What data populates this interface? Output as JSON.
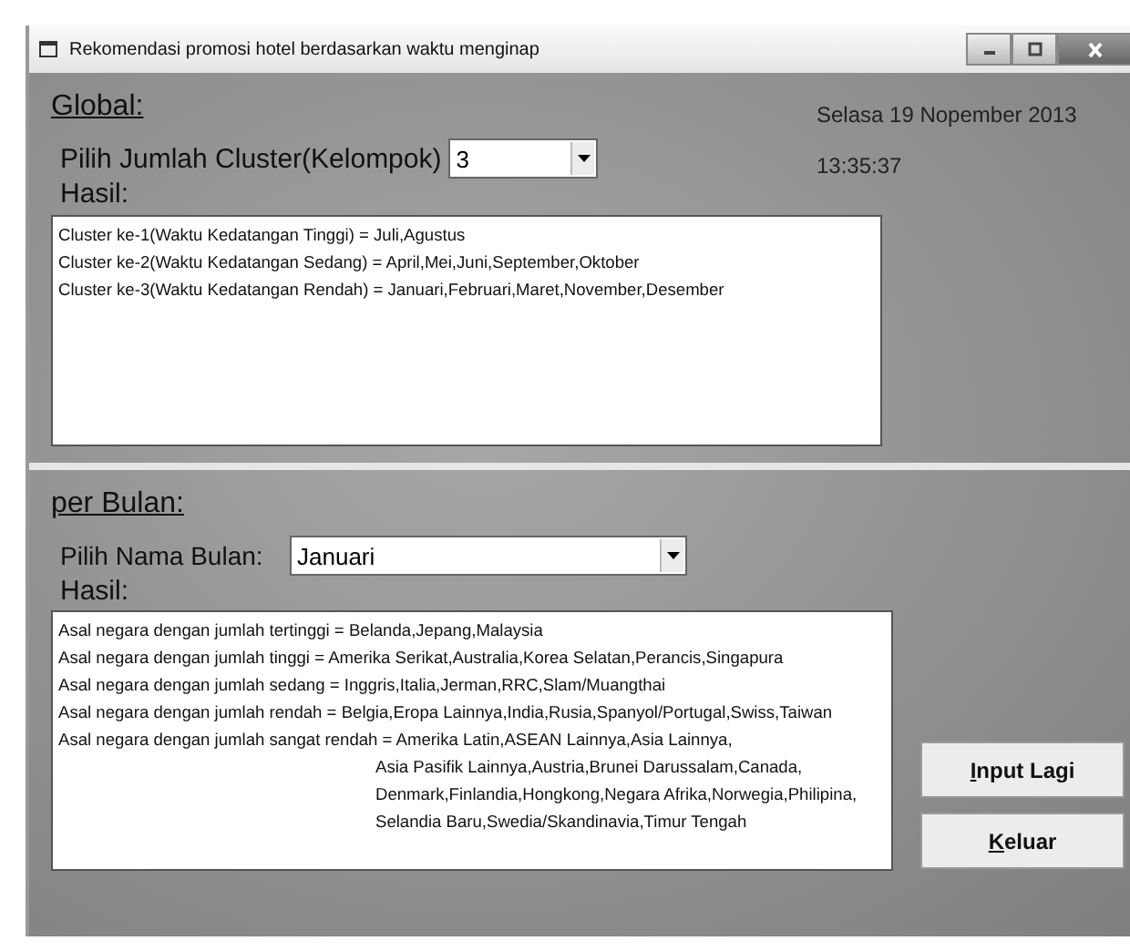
{
  "window": {
    "title": "Rekomendasi promosi hotel berdasarkan waktu menginap"
  },
  "global": {
    "heading": "Global:",
    "date": "Selasa 19 Nopember 2013",
    "time": "13:35:37",
    "cluster_label": "Pilih Jumlah Cluster(Kelompok)",
    "cluster_value": "3",
    "result_label": "Hasil:",
    "results": [
      {
        "kind": "entry",
        "text": "Cluster ke-1(Waktu Kedatangan Tinggi) = Juli,Agustus"
      },
      {
        "kind": "entry",
        "text": "Cluster ke-2(Waktu Kedatangan Sedang) = April,Mei,Juni,September,Oktober"
      },
      {
        "kind": "entry",
        "text": "Cluster ke-3(Waktu Kedatangan Rendah) = Januari,Februari,Maret,November,Desember"
      }
    ]
  },
  "per_bulan": {
    "heading": "per Bulan:",
    "month_label": "Pilih Nama Bulan:",
    "month_value": "Januari",
    "result_label": "Hasil:",
    "results": [
      {
        "kind": "entry",
        "text": "Asal negara dengan jumlah tertinggi = Belanda,Jepang,Malaysia"
      },
      {
        "kind": "entry",
        "text": "Asal negara dengan jumlah tinggi = Amerika Serikat,Australia,Korea Selatan,Perancis,Singapura"
      },
      {
        "kind": "entry",
        "text": "Asal negara dengan jumlah sedang = Inggris,Italia,Jerman,RRC,Slam/Muangthai"
      },
      {
        "kind": "entry",
        "text": "Asal negara dengan jumlah rendah = Belgia,Eropa Lainnya,India,Rusia,Spanyol/Portugal,Swiss,Taiwan"
      },
      {
        "kind": "entry",
        "text": "Asal negara dengan jumlah sangat rendah = Amerika Latin,ASEAN Lainnya,Asia Lainnya,"
      },
      {
        "kind": "continuation",
        "text": "Asia Pasifik Lainnya,Austria,Brunei Darussalam,Canada,"
      },
      {
        "kind": "continuation",
        "text": "Denmark,Finlandia,Hongkong,Negara Afrika,Norwegia,Philipina,"
      },
      {
        "kind": "continuation",
        "text": "Selandia Baru,Swedia/Skandinavia,Timur Tengah"
      }
    ]
  },
  "buttons": [
    "Input Lagi",
    "Keluar"
  ]
}
